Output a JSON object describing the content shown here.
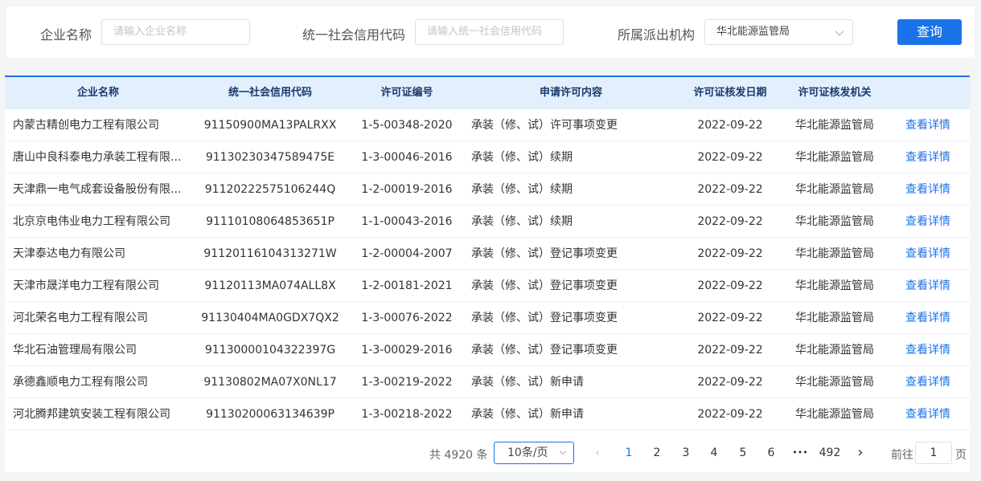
{
  "search": {
    "company_label": "企业名称",
    "company_placeholder": "请输入企业名称",
    "credit_label": "统一社会信用代码",
    "credit_placeholder": "请输入统一社会信用代码",
    "agency_label": "所属派出机构",
    "agency_value": "华北能源监管局",
    "query_label": "查询"
  },
  "table": {
    "headers": [
      "企业名称",
      "统一社会信用代码",
      "许可证编号",
      "申请许可内容",
      "许可证核发日期",
      "许可证核发机关"
    ],
    "action_label": "查看详情",
    "rows": [
      [
        "内蒙古精创电力工程有限公司",
        "91150900MA13PALRXX",
        "1-5-00348-2020",
        "承装（修、试）许可事项变更",
        "2022-09-22",
        "华北能源监管局"
      ],
      [
        "唐山中良科泰电力承装工程有限...",
        "91130230347589475E",
        "1-3-00046-2016",
        "承装（修、试）续期",
        "2022-09-22",
        "华北能源监管局"
      ],
      [
        "天津鼎一电气成套设备股份有限...",
        "91120222575106244Q",
        "1-2-00019-2016",
        "承装（修、试）续期",
        "2022-09-22",
        "华北能源监管局"
      ],
      [
        "北京京电伟业电力工程有限公司",
        "91110108064853651P",
        "1-1-00043-2016",
        "承装（修、试）续期",
        "2022-09-22",
        "华北能源监管局"
      ],
      [
        "天津泰达电力有限公司",
        "91120116104313271W",
        "1-2-00004-2007",
        "承装（修、试）登记事项变更",
        "2022-09-22",
        "华北能源监管局"
      ],
      [
        "天津市晟洋电力工程有限公司",
        "91120113MA074ALL8X",
        "1-2-00181-2021",
        "承装（修、试）登记事项变更",
        "2022-09-22",
        "华北能源监管局"
      ],
      [
        "河北荣名电力工程有限公司",
        "91130404MA0GDX7QX2",
        "1-3-00076-2022",
        "承装（修、试）登记事项变更",
        "2022-09-22",
        "华北能源监管局"
      ],
      [
        "华北石油管理局有限公司",
        "91130000104322397G",
        "1-3-00029-2016",
        "承装（修、试）登记事项变更",
        "2022-09-22",
        "华北能源监管局"
      ],
      [
        "承德鑫顺电力工程有限公司",
        "91130802MA07X0NL17",
        "1-3-00219-2022",
        "承装（修、试）新申请",
        "2022-09-22",
        "华北能源监管局"
      ],
      [
        "河北腾邦建筑安装工程有限公司",
        "91130200063134639P",
        "1-3-00218-2022",
        "承装（修、试）新申请",
        "2022-09-22",
        "华北能源监管局"
      ]
    ]
  },
  "pagination": {
    "total_text": "共 4920 条",
    "page_size": "10条/页",
    "prev": "‹",
    "pages": [
      "1",
      "2",
      "3",
      "4",
      "5",
      "6"
    ],
    "ellipsis": "•••",
    "last_page": "492",
    "next": "›",
    "current_page": "1",
    "goto_label": "前往",
    "goto_value": "1",
    "goto_unit": "页"
  }
}
